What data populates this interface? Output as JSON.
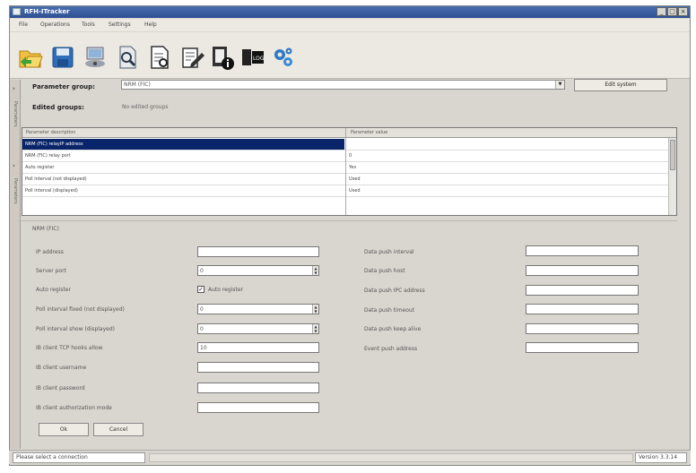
{
  "window": {
    "title": "RFH-ITracker"
  },
  "menu": [
    "File",
    "Operations",
    "Tools",
    "Settings",
    "Help"
  ],
  "toolbar_icons": [
    "open-folder-icon",
    "save-icon",
    "settings-computer-icon",
    "search-document-icon",
    "preview-document-icon",
    "edit-document-icon",
    "document-info-icon",
    "log-icon",
    "gears-icon"
  ],
  "sidebar": {
    "tab1": "Parameters",
    "tab2": "Parameters"
  },
  "params": {
    "group_label": "Parameter group:",
    "group_value": "NRM (FIC)",
    "edit_button": "Edit system",
    "edited_label": "Edited groups:",
    "edited_value": "No edited groups"
  },
  "grid": {
    "headers": [
      "Parameter description",
      "Parameter value"
    ],
    "rows": [
      {
        "desc": "NRM (FIC) relayIP address",
        "value": ""
      },
      {
        "desc": "NRM (FIC) relay port",
        "value": "0"
      },
      {
        "desc": "Auto register",
        "value": "Yes"
      },
      {
        "desc": "Poll interval (not displayed)",
        "value": "Used"
      },
      {
        "desc": "Poll interval (displayed)",
        "value": "Used"
      }
    ]
  },
  "form": {
    "group_title": "NRM (FIC)",
    "left": [
      {
        "label": "IP address",
        "value": ""
      },
      {
        "label": "Server port",
        "value": "0"
      },
      {
        "label": "Auto register",
        "value": "Auto register"
      },
      {
        "label": "Poll interval fixed (not displayed)",
        "value": "0"
      },
      {
        "label": "Poll interval show (displayed)",
        "value": "0"
      },
      {
        "label": "IB client TCP hooks allow",
        "value": "10"
      },
      {
        "label": "IB client username",
        "value": ""
      },
      {
        "label": "IB client password",
        "value": ""
      },
      {
        "label": "IB client authorization mode",
        "value": ""
      }
    ],
    "right": [
      {
        "label": "Data push interval",
        "value": ""
      },
      {
        "label": "Data push host",
        "value": ""
      },
      {
        "label": "Data push IPC address",
        "value": ""
      },
      {
        "label": "Data push timeout",
        "value": ""
      },
      {
        "label": "Data push keep alive",
        "value": ""
      },
      {
        "label": "Event push address",
        "value": ""
      }
    ],
    "ok": "Ok",
    "cancel": "Cancel"
  },
  "status": {
    "left": "Please select a connection",
    "right": "Version 3.3.14"
  },
  "colors": {
    "selection": "#0a246a",
    "title_bar": "#2d4f93"
  }
}
